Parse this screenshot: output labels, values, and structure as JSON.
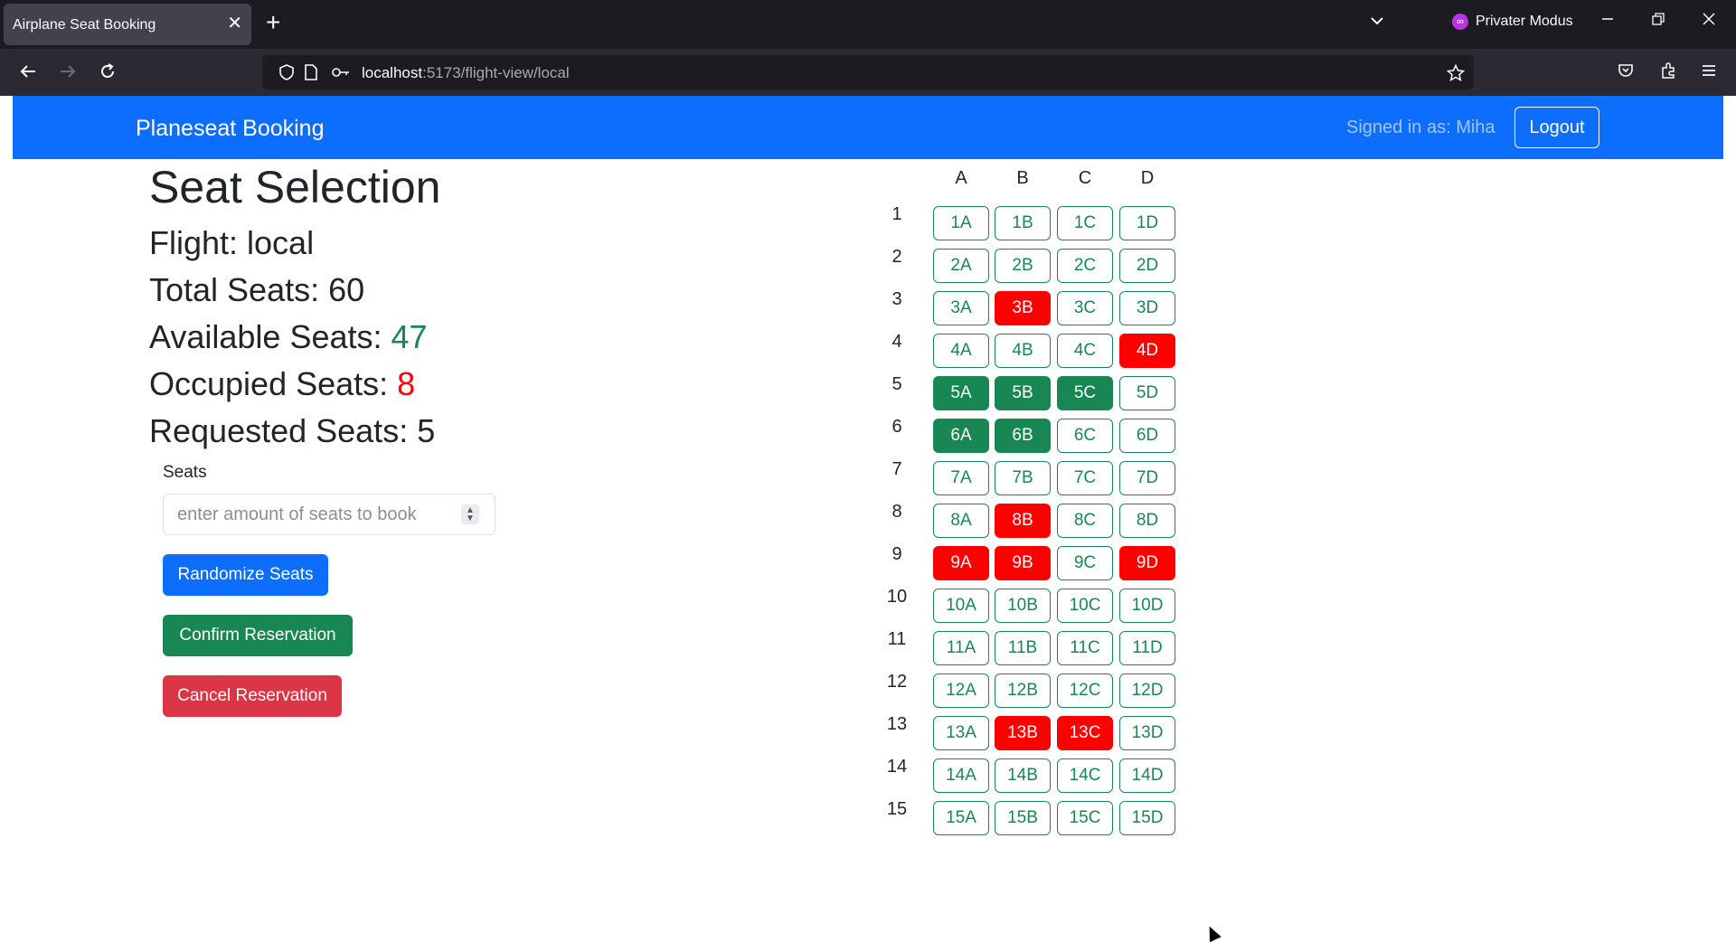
{
  "browser": {
    "tab_title": "Airplane Seat Booking",
    "tab_close": "✕",
    "new_tab": "+",
    "private_mode": "Privater Modus",
    "url_host": "localhost",
    "url_path": ":5173/flight-view/local"
  },
  "app": {
    "brand": "Planeseat Booking",
    "signed_in": "Signed in as: Miha",
    "logout": "Logout"
  },
  "summary": {
    "title": "Seat Selection",
    "flight_label": "Flight: local",
    "total_label": "Total Seats: 60",
    "available_label": "Available Seats: ",
    "available_value": "47",
    "occupied_label": "Occupied Seats: ",
    "occupied_value": "8",
    "requested_label": "Requested Seats: 5"
  },
  "form": {
    "seats_label": "Seats",
    "seats_placeholder": "enter amount of seats to book",
    "randomize": "Randomize Seats",
    "confirm": "Confirm Reservation",
    "cancel": "Cancel Reservation"
  },
  "seatmap": {
    "columns": [
      "A",
      "B",
      "C",
      "D"
    ],
    "rows": [
      "1",
      "2",
      "3",
      "4",
      "5",
      "6",
      "7",
      "8",
      "9",
      "10",
      "11",
      "12",
      "13",
      "14",
      "15"
    ],
    "occupied": [
      "3B",
      "4D",
      "8B",
      "9A",
      "9B",
      "9D",
      "13B",
      "13C"
    ],
    "requested": [
      "5A",
      "5B",
      "5C",
      "6A",
      "6B"
    ],
    "colors": {
      "available": "#198754",
      "occupied": "#ff0000",
      "requested": "#198754"
    }
  }
}
